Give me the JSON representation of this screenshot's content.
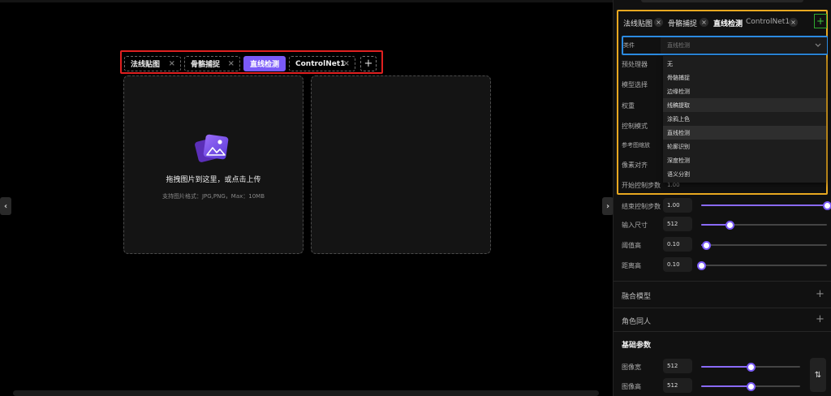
{
  "tabs": [
    {
      "label": "法线贴图",
      "close": "×"
    },
    {
      "label": "骨骼捕捉",
      "close": "×"
    },
    {
      "label": "直线检测",
      "active": true
    },
    {
      "label": "ControlNet1",
      "close": "×"
    }
  ],
  "tab_add": "+",
  "upload": {
    "title": "拖拽图片到这里，或点击上传",
    "hint": "支持图片格式：JPG,PNG，Max：10MB"
  },
  "nav": {
    "left_arrow": "‹",
    "right_arrow": "›"
  },
  "controlnet": {
    "tabs": [
      "法线贴图",
      "骨骼捕捉",
      "直线检测",
      "ControlNet1"
    ],
    "close": "×",
    "add": "+",
    "type_label": "类件",
    "type_value": "直线检测",
    "options": [
      "无",
      "骨骼捕捉",
      "边缘检测",
      "线稿提取",
      "涂鸦上色",
      "直线检测",
      "轮廓识别",
      "深度检测",
      "语义分割"
    ],
    "hidden_labels": [
      "预处理器",
      "模型选择",
      "权重",
      "控制模式",
      "参考图缩放",
      "像素对齐",
      "开始控制步数"
    ],
    "partial_value": "1.00"
  },
  "params": [
    {
      "label": "结束控制步数",
      "value": "1.00",
      "fraction": 1.0
    },
    {
      "label": "输入尺寸",
      "value": "512",
      "fraction": 0.23
    },
    {
      "label": "阈值高",
      "value": "0.10",
      "fraction": 0.04
    },
    {
      "label": "距离高",
      "value": "0.10",
      "fraction": 0.0
    }
  ],
  "sections": [
    {
      "title": "融合模型",
      "icon": "+"
    },
    {
      "title": "角色同人",
      "icon": "+"
    }
  ],
  "basic": {
    "title": "基础参数",
    "rows": [
      {
        "label": "图像宽",
        "value": "512",
        "fraction": 0.5
      },
      {
        "label": "图像高",
        "value": "512",
        "fraction": 0.5
      }
    ],
    "swap": "⇅"
  },
  "colors": {
    "accent": "#7a5af8",
    "red_box": "#e02020",
    "orange_box": "#e8a820",
    "blue_box": "#2b8ae0",
    "green_box": "#2ea82e"
  }
}
